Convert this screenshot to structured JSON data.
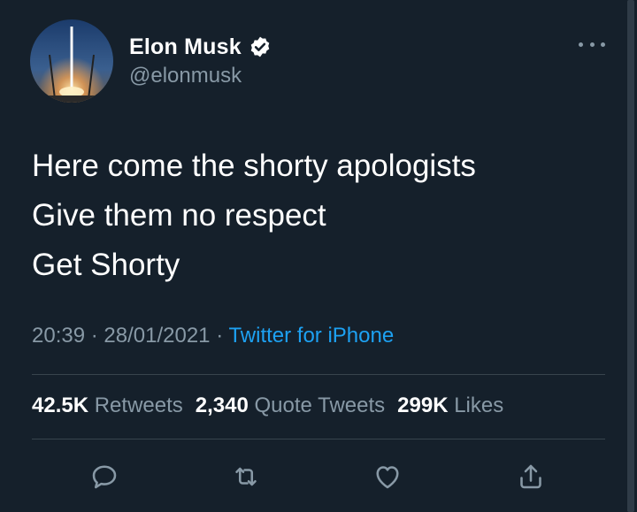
{
  "author": {
    "display_name": "Elon Musk",
    "handle": "@elonmusk",
    "verified": true,
    "avatar_icon": "rocket-launch-avatar"
  },
  "tweet": {
    "lines": [
      "Here come the shorty apologists",
      "Give them no respect",
      "Get Shorty"
    ]
  },
  "meta": {
    "time": "20:39",
    "separator": "·",
    "date": "28/01/2021",
    "source": "Twitter for iPhone"
  },
  "stats": {
    "retweets_count": "42.5K",
    "retweets_label": "Retweets",
    "quote_count": "2,340",
    "quote_label": "Quote Tweets",
    "likes_count": "299K",
    "likes_label": "Likes"
  },
  "actions": [
    "reply-icon",
    "retweet-icon",
    "like-icon",
    "share-icon"
  ],
  "colors": {
    "background": "#15202b",
    "text": "#ffffff",
    "muted": "#8899a6",
    "link": "#1da1f2",
    "divider": "#38444d"
  }
}
